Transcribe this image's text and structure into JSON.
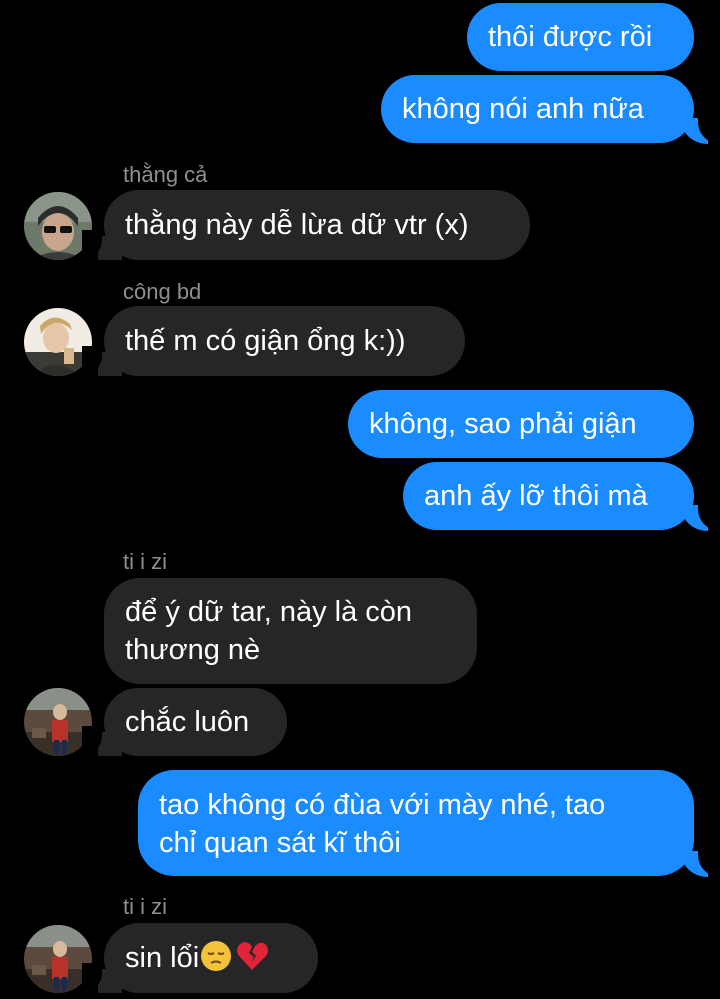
{
  "conversation": {
    "messages": [
      {
        "id": "m1",
        "direction": "outgoing",
        "text": "thôi được rồi"
      },
      {
        "id": "m2",
        "direction": "outgoing",
        "text": "không nói anh nữa"
      },
      {
        "id": "m3",
        "direction": "incoming",
        "sender": "thằng cả",
        "text": "thằng này dễ lừa dữ vtr (x)"
      },
      {
        "id": "m4",
        "direction": "incoming",
        "sender": "công bd",
        "text": "thế m có giận ổng k:))"
      },
      {
        "id": "m5",
        "direction": "outgoing",
        "text": "không, sao phải giận"
      },
      {
        "id": "m6",
        "direction": "outgoing",
        "text": "anh ấy lỡ thôi mà"
      },
      {
        "id": "m7",
        "direction": "incoming",
        "sender": "ti i zi",
        "text_line1": "để ý dữ tar, này là còn",
        "text_line2": "thương nè"
      },
      {
        "id": "m8",
        "direction": "incoming",
        "text": "chắc luôn"
      },
      {
        "id": "m9",
        "direction": "outgoing",
        "text_line1": "tao không có đùa với mày nhé, tao",
        "text_line2": "chỉ quan sát kĩ thôi"
      },
      {
        "id": "m10",
        "direction": "incoming",
        "sender": "ti i zi",
        "text": "sin lổi",
        "emojis": [
          "pensive-face-emoji",
          "broken-heart-emoji"
        ]
      }
    ]
  },
  "colors": {
    "background": "#000000",
    "outgoing_bubble": "#1a8cff",
    "incoming_bubble": "#262628",
    "sender_label": "#8e8e93",
    "text": "#ffffff"
  }
}
